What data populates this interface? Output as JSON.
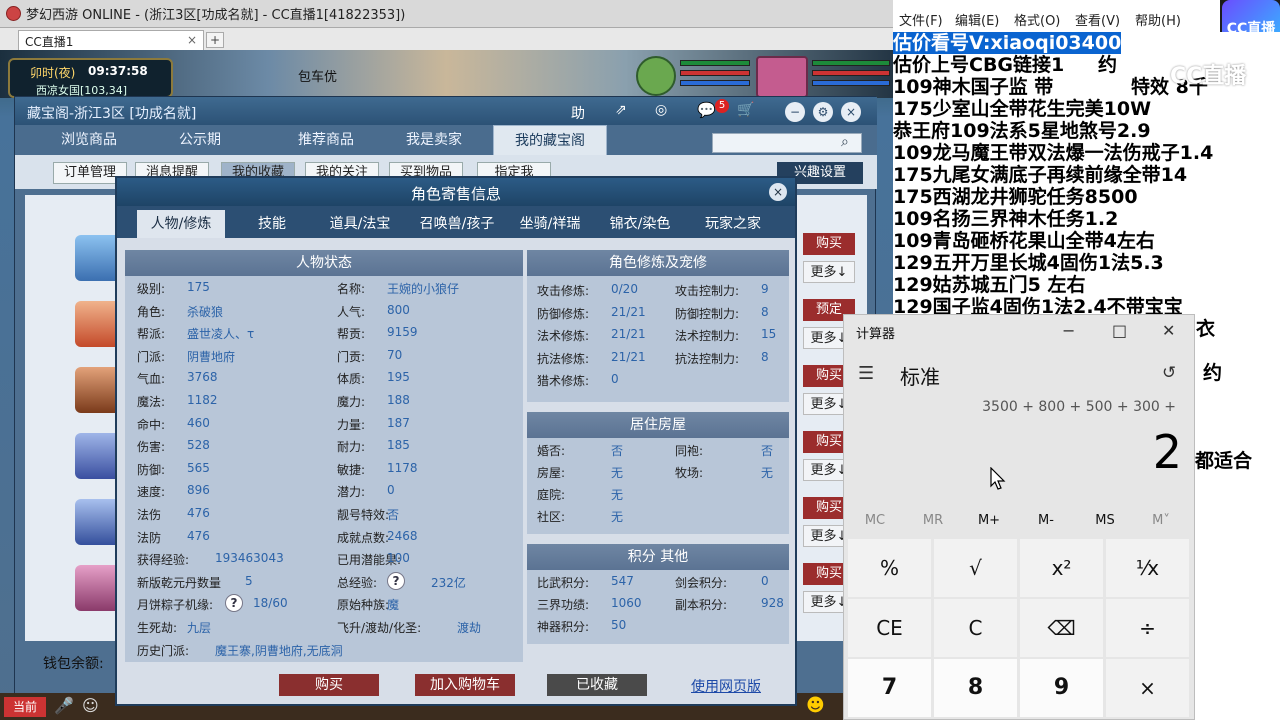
{
  "game_window": {
    "title": "梦幻西游 ONLINE - (浙江3区[功成名就] - CC直播1[41822353])",
    "tab_label": "CC直播1",
    "tab_close": "×",
    "tab_add": "+",
    "clock_period": "卯时(夜)",
    "clock_time": "09:37:58",
    "map_text": "西凉女国[103,34]",
    "baoche_text": "包车优"
  },
  "cbg": {
    "title": "藏宝阁-浙江3区 [功成名就]",
    "help_label": "助",
    "cart_badge": "5",
    "nav": [
      "浏览商品",
      "公示期",
      "推荐商品",
      "我是卖家",
      "我的藏宝阁"
    ],
    "sub": [
      "订单管理",
      "消息提醒",
      "我的收藏",
      "我的关注",
      "买到物品",
      "指定我"
    ],
    "interest_label": "兴趣设置",
    "buy_label": "购买",
    "more_label": "更多↓",
    "reserve_label": "预定",
    "wallet_label": "钱包余额:"
  },
  "popup": {
    "title": "角色寄售信息",
    "close": "×",
    "tabs": [
      "人物/修炼",
      "技能",
      "道具/法宝",
      "召唤兽/孩子",
      "坐骑/祥瑞",
      "锦衣/染色",
      "玩家之家"
    ],
    "status_title": "人物状态",
    "left_col": [
      {
        "k": "级别:",
        "v": "175"
      },
      {
        "k": "角色:",
        "v": "杀破狼"
      },
      {
        "k": "帮派:",
        "v": "盛世凌人、τ"
      },
      {
        "k": "门派:",
        "v": "阴曹地府"
      },
      {
        "k": "气血:",
        "v": "3768"
      },
      {
        "k": "魔法:",
        "v": "1182"
      },
      {
        "k": "命中:",
        "v": "460"
      },
      {
        "k": "伤害:",
        "v": "528"
      },
      {
        "k": "防御:",
        "v": "565"
      },
      {
        "k": "速度:",
        "v": "896"
      },
      {
        "k": "法伤",
        "v": "476"
      },
      {
        "k": "法防",
        "v": "476"
      },
      {
        "k": "获得经验:",
        "v": "193463043"
      },
      {
        "k": "新版乾元丹数量",
        "v": "5"
      },
      {
        "k": "月饼粽子机缘:",
        "v": "18/60"
      },
      {
        "k": "生死劫:",
        "v": "九层"
      },
      {
        "k": "历史门派:",
        "v": "魔王寨,阴曹地府,无底洞"
      }
    ],
    "mid_col": [
      {
        "k": "名称:",
        "v": "王婉的小狼仔"
      },
      {
        "k": "人气:",
        "v": "800"
      },
      {
        "k": "帮贡:",
        "v": "9159"
      },
      {
        "k": "门贡:",
        "v": "70"
      },
      {
        "k": "体质:",
        "v": "195"
      },
      {
        "k": "魔力:",
        "v": "188"
      },
      {
        "k": "力量:",
        "v": "187"
      },
      {
        "k": "耐力:",
        "v": "185"
      },
      {
        "k": "敏捷:",
        "v": "1178"
      },
      {
        "k": "潜力:",
        "v": "0"
      },
      {
        "k": "靓号特效:",
        "v": "否"
      },
      {
        "k": "成就点数:",
        "v": "2468"
      },
      {
        "k": "已用潜能果:",
        "v": "100"
      },
      {
        "k": "总经验:",
        "v": "232亿"
      },
      {
        "k": "原始种族:",
        "v": "魔"
      },
      {
        "k": "飞升/渡劫/化圣:",
        "v": "渡劫"
      }
    ],
    "cultivation_title": "角色修炼及宠修",
    "cultivation": [
      {
        "k": "攻击修炼:",
        "v": "0/20",
        "k2": "攻击控制力:",
        "v2": "9"
      },
      {
        "k": "防御修炼:",
        "v": "21/21",
        "k2": "防御控制力:",
        "v2": "8"
      },
      {
        "k": "法术修炼:",
        "v": "21/21",
        "k2": "法术控制力:",
        "v2": "15"
      },
      {
        "k": "抗法修炼:",
        "v": "21/21",
        "k2": "抗法控制力:",
        "v2": "8"
      },
      {
        "k": "猎术修炼:",
        "v": "0",
        "k2": "",
        "v2": ""
      }
    ],
    "house_title": "居住房屋",
    "house": [
      {
        "k": "婚否:",
        "v": "否",
        "k2": "同袍:",
        "v2": "否"
      },
      {
        "k": "房屋:",
        "v": "无",
        "k2": "牧场:",
        "v2": "无"
      },
      {
        "k": "庭院:",
        "v": "无",
        "k2": "",
        "v2": ""
      },
      {
        "k": "社区:",
        "v": "无",
        "k2": "",
        "v2": ""
      }
    ],
    "score_title": "积分 其他",
    "score": [
      {
        "k": "比武积分:",
        "v": "547",
        "k2": "剑会积分:",
        "v2": "0"
      },
      {
        "k": "三界功绩:",
        "v": "1060",
        "k2": "副本积分:",
        "v2": "928"
      },
      {
        "k": "神器积分:",
        "v": "50",
        "k2": "",
        "v2": ""
      }
    ],
    "qmark": "?",
    "btn_buy": "购买",
    "btn_cart": "加入购物车",
    "btn_fav": "已收藏",
    "btn_web": "使用网页版"
  },
  "notepad": {
    "menu": [
      "文件(F)",
      "编辑(E)",
      "格式(O)",
      "查看(V)",
      "帮助(H)"
    ],
    "lines": [
      "估价看号V:xiaoqi03400",
      "估价上号CBG链接1",
      "109神木国子监 带",
      "175少室山全带花生完美10W",
      "恭王府109法系5星地煞号2.9",
      "109龙马魔王带双法爆一法伤戒子1.4",
      "175九尾女满底子再续前缘全带14",
      "175西湖龙井狮驼任务8500",
      "109名扬三界神木任务1.2",
      "109青岛砸桥花果山全带4左右",
      "129五开万里长城4固伤1法5.3",
      "129姑苏城五门5 左右",
      "129国子监4固伤1法2.4不带宝宝"
    ],
    "line_tail_1": "约",
    "line_tail_2": "特效 8千",
    "side_1": "衣",
    "side_2": "约",
    "side_3": "都适合",
    "cc_logo": "CC直播",
    "cc_watermark": "CC直播"
  },
  "calculator": {
    "title": "计算器",
    "mode": "标准",
    "expression": "3500 + 800 + 500 + 300 +",
    "display": "2",
    "memory": [
      "MC",
      "MR",
      "M+",
      "M-",
      "MS",
      "M˅"
    ],
    "keys": [
      [
        "%",
        "√",
        "x²",
        "⅟x"
      ],
      [
        "CE",
        "C",
        "⌫",
        "÷"
      ],
      [
        "7",
        "8",
        "9",
        "×"
      ]
    ]
  }
}
